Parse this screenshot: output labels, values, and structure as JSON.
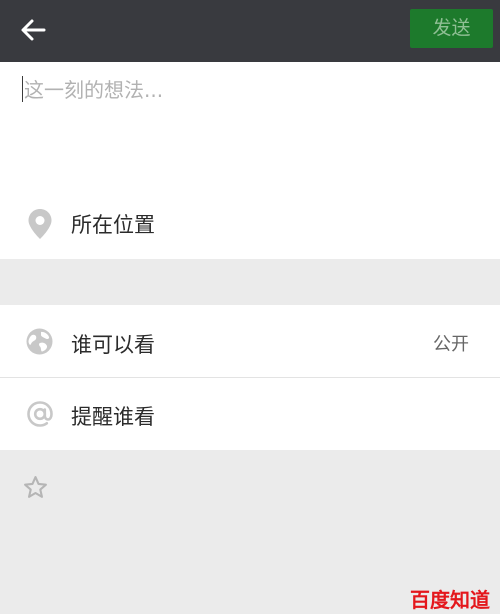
{
  "header": {
    "send_label": "发送"
  },
  "compose": {
    "placeholder": "这一刻的想法..."
  },
  "location": {
    "label": "所在位置"
  },
  "visibility": {
    "label": "谁可以看",
    "value": "公开"
  },
  "mention": {
    "label": "提醒谁看"
  },
  "watermark": {
    "text": "百度知道"
  },
  "colors": {
    "topbar": "#393a3f",
    "send_button": "#1d7a2c",
    "page_bg": "#ebebeb"
  },
  "icons": [
    "back-arrow-icon",
    "location-pin-icon",
    "globe-icon",
    "at-icon",
    "star-icon"
  ]
}
